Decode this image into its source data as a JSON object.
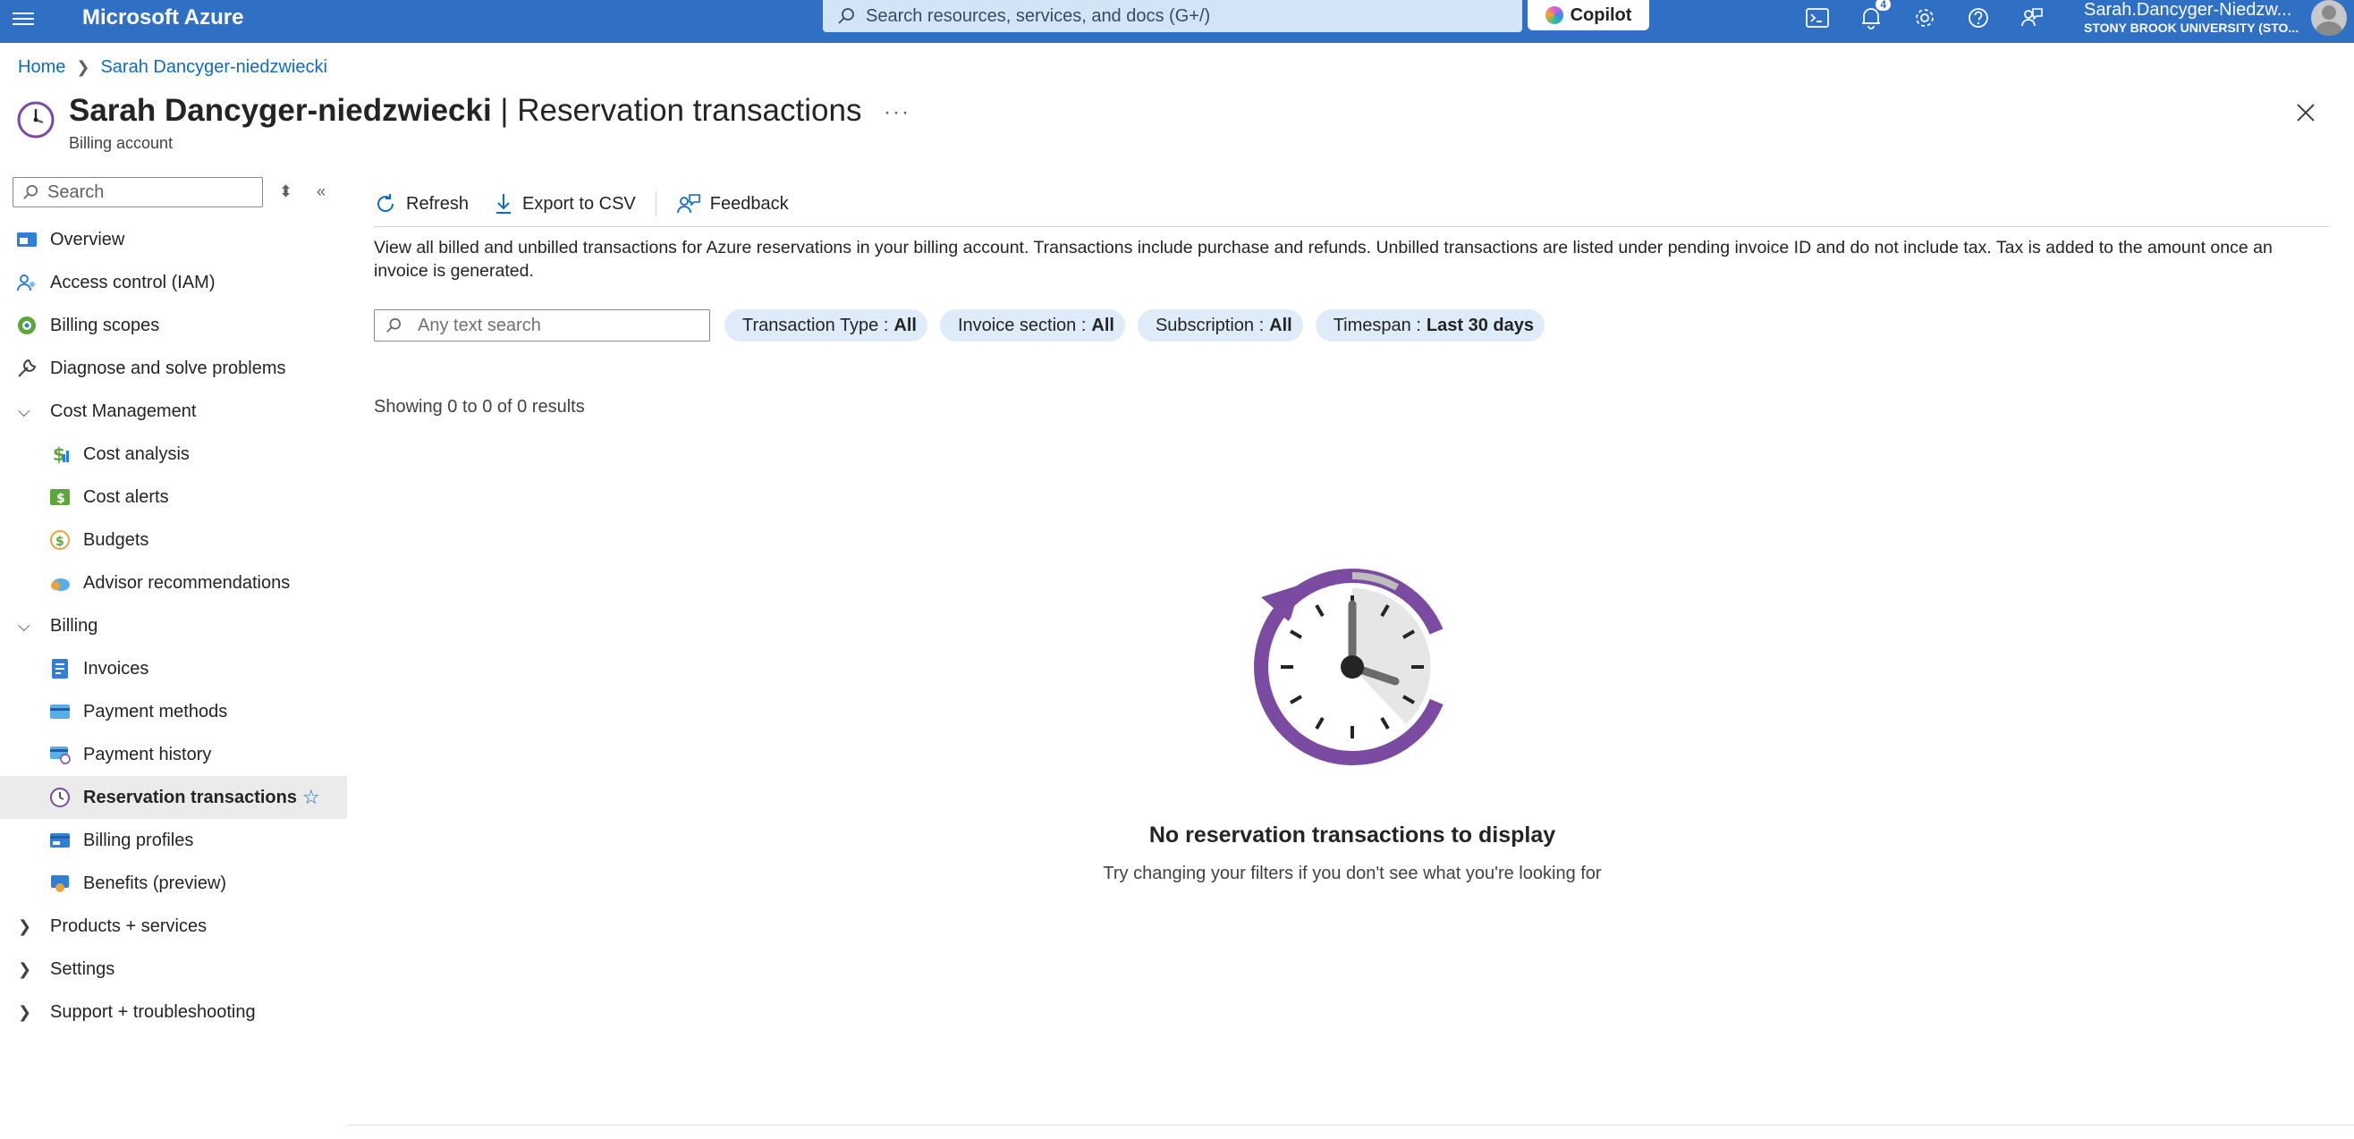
{
  "topbar": {
    "brand": "Microsoft Azure",
    "search_placeholder": "Search resources, services, and docs (G+/)",
    "copilot_label": "Copilot",
    "notification_count": "4",
    "user_name": "Sarah.Dancyger-Niedzw...",
    "user_org": "STONY BROOK UNIVERSITY (STO..."
  },
  "breadcrumb": {
    "home": "Home",
    "current": "Sarah Dancyger-niedzwiecki"
  },
  "header": {
    "title_name": "Sarah Dancyger-niedzwiecki",
    "title_sep": " | ",
    "title_page": "Reservation transactions",
    "subtitle": "Billing account",
    "more": "···"
  },
  "sidebar": {
    "search_placeholder": "Search",
    "items": [
      {
        "label": "Overview",
        "icon": "overview-icon"
      },
      {
        "label": "Access control (IAM)",
        "icon": "iam-icon"
      },
      {
        "label": "Billing scopes",
        "icon": "billing-scopes-icon"
      },
      {
        "label": "Diagnose and solve problems",
        "icon": "wrench-icon"
      },
      {
        "label": "Cost Management",
        "group": true
      },
      {
        "label": "Cost analysis",
        "icon": "cost-analysis-icon"
      },
      {
        "label": "Cost alerts",
        "icon": "cost-alerts-icon"
      },
      {
        "label": "Budgets",
        "icon": "budgets-icon"
      },
      {
        "label": "Advisor recommendations",
        "icon": "advisor-icon"
      },
      {
        "label": "Billing",
        "group": true
      },
      {
        "label": "Invoices",
        "icon": "invoices-icon"
      },
      {
        "label": "Payment methods",
        "icon": "payment-methods-icon"
      },
      {
        "label": "Payment history",
        "icon": "payment-history-icon"
      },
      {
        "label": "Reservation transactions",
        "icon": "clock-icon",
        "active": true
      },
      {
        "label": "Billing profiles",
        "icon": "billing-profiles-icon"
      },
      {
        "label": "Benefits (preview)",
        "icon": "benefits-icon"
      },
      {
        "label": "Products + services",
        "group": true
      },
      {
        "label": "Settings",
        "group": true
      },
      {
        "label": "Support + troubleshooting",
        "group": true
      }
    ]
  },
  "toolbar": {
    "refresh": "Refresh",
    "export": "Export to CSV",
    "feedback": "Feedback"
  },
  "content": {
    "description": "View all billed and unbilled transactions for Azure reservations in your billing account. Transactions include purchase and refunds. Unbilled transactions are listed under pending invoice ID and do not include tax. Tax is added to the amount once an invoice is generated.",
    "text_search_placeholder": "Any text search",
    "filters": [
      {
        "label": "Transaction Type :",
        "value": "All"
      },
      {
        "label": "Invoice section :",
        "value": "All"
      },
      {
        "label": "Subscription :",
        "value": "All"
      },
      {
        "label": "Timespan :",
        "value": "Last 30 days"
      }
    ],
    "results": "Showing 0 to 0 of 0 results",
    "empty_title": "No reservation transactions to display",
    "empty_subtitle": "Try changing your filters if you don't see what you're looking for"
  },
  "colors": {
    "topbar": "#2f6fc4",
    "link": "#0f6cbd",
    "accent_purple": "#7b4ba1",
    "pill_bg": "#deecf9"
  }
}
